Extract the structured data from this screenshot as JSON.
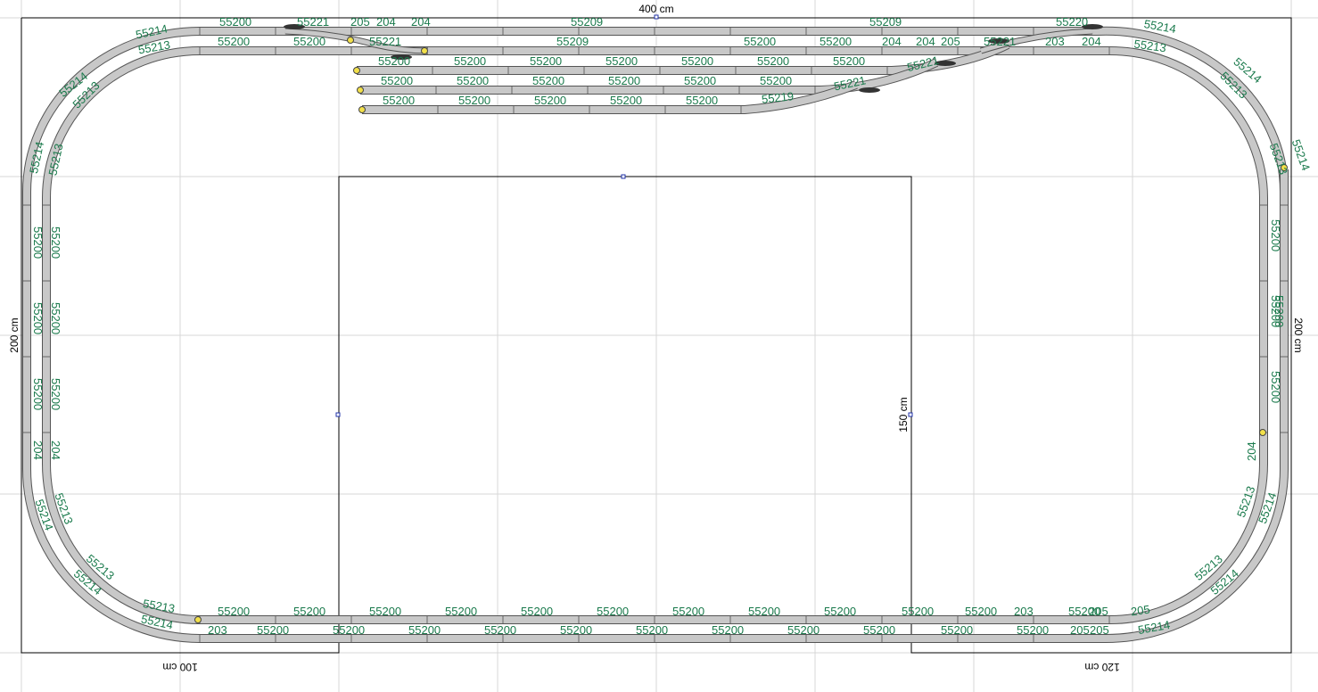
{
  "dimensions": {
    "top": "400 cm",
    "left": "200 cm",
    "right": "200 cm",
    "inner": "150 cm",
    "bottom_left": "100 cm",
    "bottom_right": "120 cm"
  },
  "colors": {
    "track_fill": "#c8c8c8",
    "track_edge": "#555555",
    "label": "#1a7a4c",
    "grid": "#d7d7d7",
    "end_marker": "#f2e04a"
  },
  "labels": {
    "outer_top": [
      "55214",
      "55200",
      "55221",
      "205",
      "204",
      "204",
      "55209",
      "55209",
      "55220",
      "55214"
    ],
    "inner_top": [
      "55213",
      "55200",
      "55200",
      "55221",
      "55209",
      "55200",
      "55200",
      "204",
      "204",
      "205",
      "55221",
      "203",
      "204",
      "55213"
    ],
    "sidings_1": [
      "55200",
      "55200",
      "55200",
      "55200",
      "55200",
      "55200",
      "55200",
      "55221"
    ],
    "sidings_2": [
      "55200",
      "55200",
      "55200",
      "55200",
      "55200",
      "55200",
      "55221"
    ],
    "sidings_3": [
      "55200",
      "55200",
      "55200",
      "55200",
      "55200",
      "55219"
    ],
    "left_side": [
      "55214",
      "55213",
      "55214",
      "55213",
      "55200",
      "55200",
      "55200",
      "55200",
      "55200",
      "55200",
      "204",
      "204",
      "55213",
      "55214",
      "55213",
      "55214"
    ],
    "right_side": [
      "55214",
      "55213",
      "55214",
      "55213",
      "55200",
      "55200",
      "55200",
      "55200",
      "204",
      "55213",
      "55214",
      "55213",
      "55214"
    ],
    "inner_bottom": [
      "55213",
      "55200",
      "55200",
      "55200",
      "55200",
      "55200",
      "55200",
      "55200",
      "55200",
      "55200",
      "55200",
      "55200",
      "203",
      "55200",
      "205",
      "205",
      "55213"
    ],
    "outer_bottom": [
      "55214",
      "203",
      "55200",
      "55200",
      "55200",
      "55200",
      "55200",
      "55200",
      "55200",
      "55200",
      "55200",
      "55200",
      "55200",
      "55200",
      "205",
      "205",
      "55214"
    ]
  }
}
